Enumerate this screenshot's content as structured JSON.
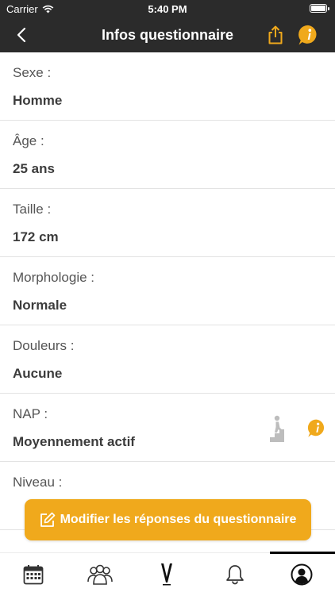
{
  "status_bar": {
    "carrier": "Carrier",
    "time": "5:40 PM",
    "battery_level": 1.0
  },
  "header": {
    "title": "Infos questionnaire",
    "back_icon": "chevron-left-icon",
    "share_icon": "share-icon",
    "info_icon": "info-icon"
  },
  "rows": [
    {
      "label": "Sexe :",
      "value": "Homme"
    },
    {
      "label": "Âge :",
      "value": "25 ans"
    },
    {
      "label": "Taille :",
      "value": "172 cm"
    },
    {
      "label": "Morphologie :",
      "value": "Normale"
    },
    {
      "label": "Douleurs :",
      "value": "Aucune"
    },
    {
      "label": "NAP :",
      "value": "Moyennement actif"
    },
    {
      "label": "Niveau :",
      "value": ""
    }
  ],
  "cta": {
    "label": "Modifier les réponses du questionnaire",
    "icon": "edit-icon"
  },
  "tabbar": {
    "items": [
      {
        "icon": "calendar-icon"
      },
      {
        "icon": "group-icon"
      },
      {
        "icon": "brand-logo-icon"
      },
      {
        "icon": "bell-icon"
      },
      {
        "icon": "profile-icon"
      }
    ],
    "selected_index": 4
  },
  "colors": {
    "accent": "#f0a91c",
    "header_bg": "#2b2b2b",
    "text": "#3c3c3c",
    "divider": "#e3e3e3"
  }
}
